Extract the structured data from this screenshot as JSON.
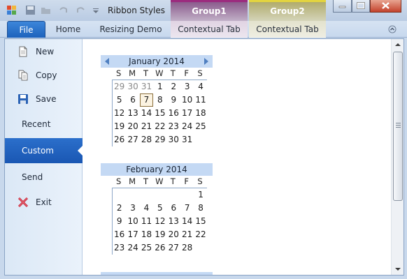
{
  "window": {
    "title": "Ribbon Styles"
  },
  "contextual_groups": [
    {
      "label": "Group1",
      "color": "#9c2b7e"
    },
    {
      "label": "Group2",
      "color": "#e3d43f"
    }
  ],
  "tabs": {
    "file": "File",
    "home": "Home",
    "resizing": "Resizing Demo",
    "contextual1": "Contextual Tab",
    "contextual2": "Contextual Tab"
  },
  "backstage": {
    "items": [
      {
        "label": "New",
        "icon": "new-document-icon"
      },
      {
        "label": "Copy",
        "icon": "copy-icon"
      },
      {
        "label": "Save",
        "icon": "save-icon"
      },
      {
        "label": "Recent",
        "icon": ""
      },
      {
        "label": "Custom",
        "icon": "",
        "active": true
      },
      {
        "label": "Send",
        "icon": ""
      },
      {
        "label": "Exit",
        "icon": "exit-icon"
      }
    ]
  },
  "calendars": [
    {
      "month": "January 2014",
      "days_of_week": [
        "S",
        "M",
        "T",
        "W",
        "T",
        "F",
        "S"
      ],
      "weeks": [
        [
          "29",
          "30",
          "31",
          "1",
          "2",
          "3",
          "4"
        ],
        [
          "5",
          "6",
          "7",
          "8",
          "9",
          "10",
          "11"
        ],
        [
          "12",
          "13",
          "14",
          "15",
          "16",
          "17",
          "18"
        ],
        [
          "19",
          "20",
          "21",
          "22",
          "23",
          "24",
          "25"
        ],
        [
          "26",
          "27",
          "28",
          "29",
          "30",
          "31",
          ""
        ]
      ],
      "leading_other_month_days": 3,
      "today": "7"
    },
    {
      "month": "February 2014",
      "days_of_week": [
        "S",
        "M",
        "T",
        "W",
        "T",
        "F",
        "S"
      ],
      "weeks": [
        [
          "",
          "",
          "",
          "",
          "",
          "",
          "1"
        ],
        [
          "2",
          "3",
          "4",
          "5",
          "6",
          "7",
          "8"
        ],
        [
          "9",
          "10",
          "11",
          "12",
          "13",
          "14",
          "15"
        ],
        [
          "16",
          "17",
          "18",
          "19",
          "20",
          "21",
          "22"
        ],
        [
          "23",
          "24",
          "25",
          "26",
          "27",
          "28",
          ""
        ]
      ]
    }
  ],
  "colors": {
    "accent": "#1d62bc",
    "calendar_header": "#c4d9f4"
  }
}
